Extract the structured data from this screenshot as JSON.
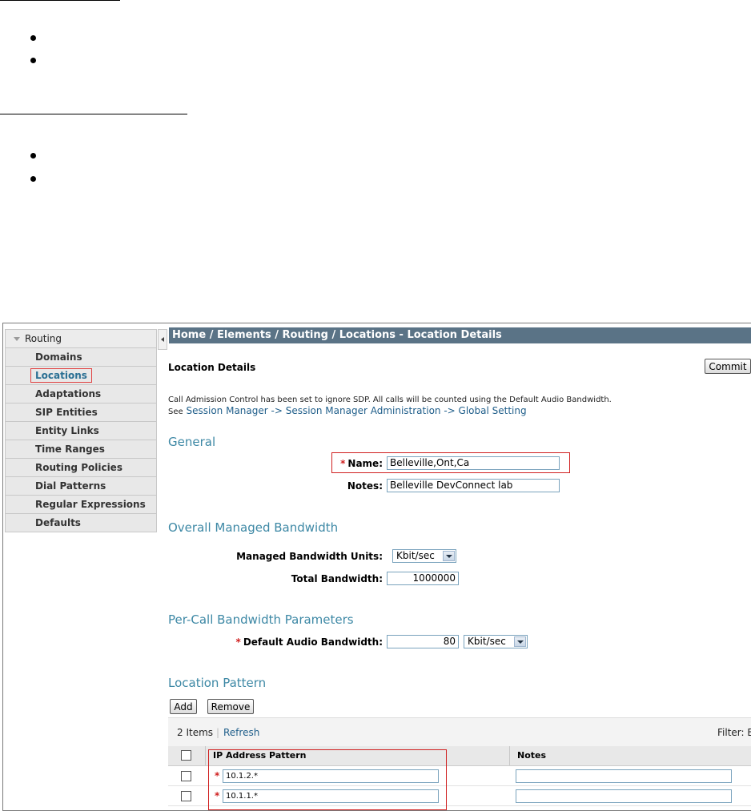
{
  "app": {
    "breadcrumb": "Home / Elements / Routing / Locations - Location Details"
  },
  "sidebar": {
    "header": "Routing",
    "items": [
      {
        "label": "Domains"
      },
      {
        "label": "Locations"
      },
      {
        "label": "Adaptations"
      },
      {
        "label": "SIP Entities"
      },
      {
        "label": "Entity Links"
      },
      {
        "label": "Time Ranges"
      },
      {
        "label": "Routing Policies"
      },
      {
        "label": "Dial Patterns"
      },
      {
        "label": "Regular Expressions"
      },
      {
        "label": "Defaults"
      }
    ],
    "active": "Locations"
  },
  "page": {
    "title": "Location Details",
    "commit_label": "Commit",
    "cac_note": "Call Admission Control has been set to ignore SDP. All calls will be counted using the Default Audio Bandwidth.",
    "see_prefix": "See",
    "see_link": "Session Manager -> Session Manager Administration -> Global Setting"
  },
  "general": {
    "heading": "General",
    "name_label": "Name:",
    "name_value": "Belleville,Ont,Ca",
    "notes_label": "Notes:",
    "notes_value": "Belleville DevConnect lab"
  },
  "bandwidth": {
    "heading": "Overall Managed Bandwidth",
    "units_label": "Managed Bandwidth Units:",
    "units_value": "Kbit/sec",
    "total_label": "Total Bandwidth:",
    "total_value": "1000000"
  },
  "per_call": {
    "heading": "Per-Call Bandwidth Parameters",
    "default_label": "Default Audio Bandwidth:",
    "default_value": "80",
    "default_unit": "Kbit/sec"
  },
  "location_pattern": {
    "heading": "Location Pattern",
    "add_label": "Add",
    "remove_label": "Remove",
    "count_text": "2 Items",
    "separator": "|",
    "refresh_label": "Refresh",
    "filter_label": "Filter: E",
    "columns": [
      "IP Address Pattern",
      "Notes"
    ],
    "rows": [
      {
        "pattern": "10.1.2.*",
        "notes": ""
      },
      {
        "pattern": "10.1.1.*",
        "notes": ""
      }
    ]
  }
}
